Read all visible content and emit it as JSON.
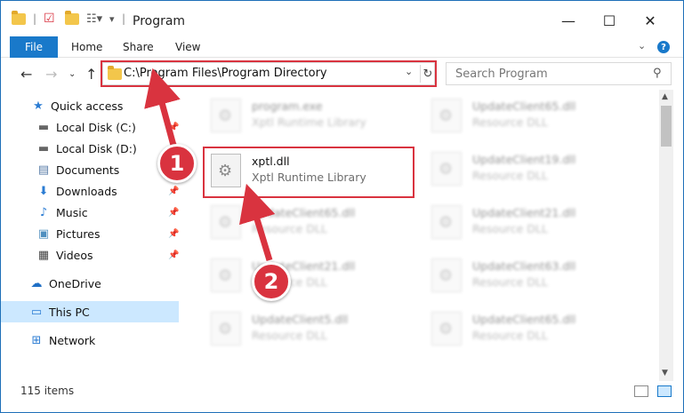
{
  "window": {
    "title": "Program",
    "minimize": "—",
    "maximize": "☐",
    "close": "✕"
  },
  "ribbon": {
    "file": "File",
    "home": "Home",
    "share": "Share",
    "view": "View",
    "help": "?"
  },
  "address": {
    "path": "C:\\Program Files\\Program Directory",
    "search_placeholder": "Search Program"
  },
  "sidebar": {
    "items": [
      {
        "label": "Quick access",
        "icon": "star-icon"
      },
      {
        "label": "Local Disk (C:)",
        "icon": "drive-icon",
        "pinned": true
      },
      {
        "label": "Local Disk (D:)",
        "icon": "drive-icon",
        "pinned": true
      },
      {
        "label": "Documents",
        "icon": "documents-icon",
        "pinned": true
      },
      {
        "label": "Downloads",
        "icon": "download-icon",
        "pinned": true
      },
      {
        "label": "Music",
        "icon": "music-icon",
        "pinned": true
      },
      {
        "label": "Pictures",
        "icon": "pictures-icon",
        "pinned": true
      },
      {
        "label": "Videos",
        "icon": "videos-icon",
        "pinned": true
      },
      {
        "label": "OneDrive",
        "icon": "cloud-icon"
      },
      {
        "label": "This PC",
        "icon": "computer-icon",
        "selected": true
      },
      {
        "label": "Network",
        "icon": "network-icon"
      }
    ]
  },
  "files": [
    {
      "name": "program.exe",
      "desc": "Xptl Runtime Library"
    },
    {
      "name": "xptl.dll",
      "desc": "Xptl Runtime Library"
    },
    {
      "name": "UpdateClient65.dll",
      "desc": "Resource DLL"
    },
    {
      "name": "UpdateClient21.dll",
      "desc": "Resource DLL"
    },
    {
      "name": "UpdateClient5.dll",
      "desc": "Resource DLL"
    },
    {
      "name": "UpdateClient65.dll",
      "desc": "Resource DLL"
    },
    {
      "name": "UpdateClient19.dll",
      "desc": "Resource DLL"
    },
    {
      "name": "UpdateClient21.dll",
      "desc": "Resource DLL"
    },
    {
      "name": "UpdateClient63.dll",
      "desc": "Resource DLL"
    },
    {
      "name": "UpdateClient65.dll",
      "desc": "Resource DLL"
    }
  ],
  "status": {
    "count": "115 items"
  },
  "callouts": {
    "one": "1",
    "two": "2"
  },
  "colors": {
    "accent": "#1979ca",
    "highlight": "#d9333f"
  }
}
